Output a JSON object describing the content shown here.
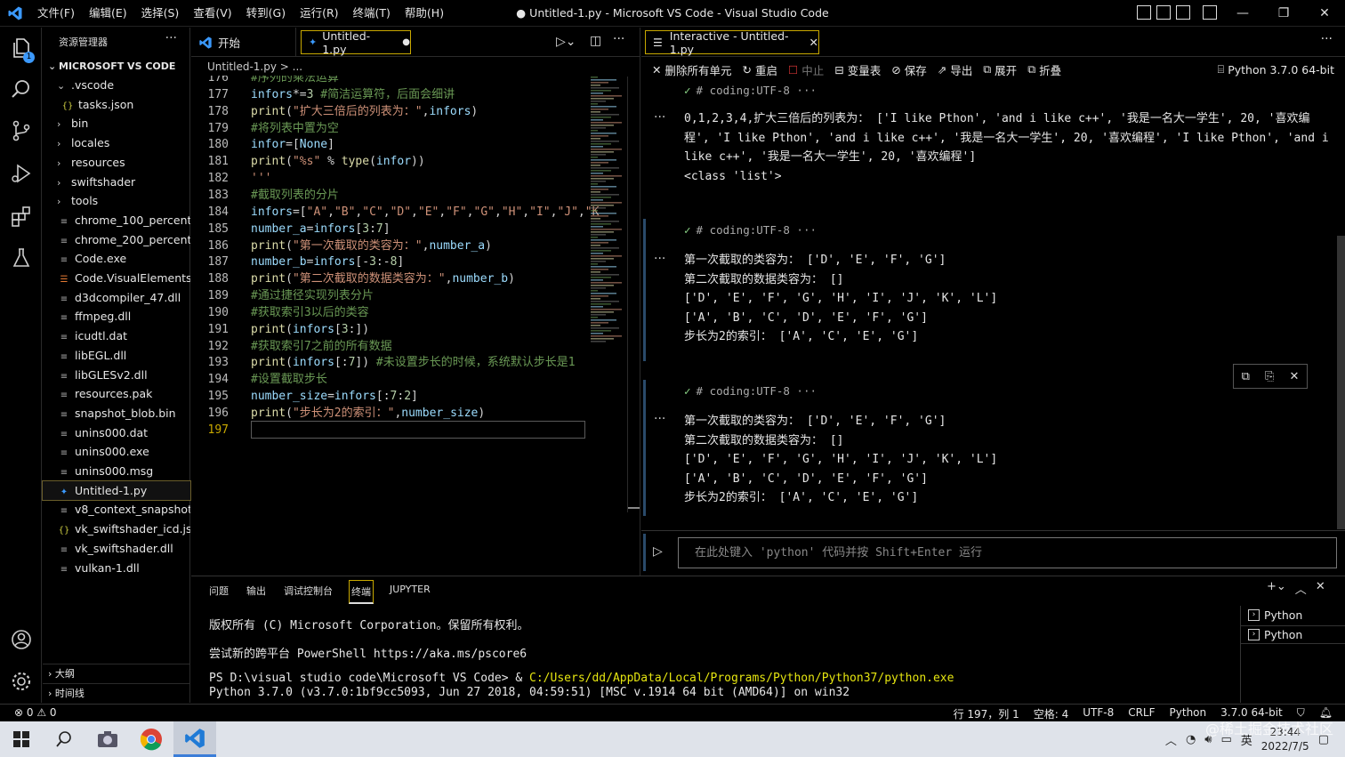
{
  "window": {
    "title": "● Untitled-1.py - Microsoft VS Code - Visual Studio Code",
    "menus": [
      "文件(F)",
      "编辑(E)",
      "选择(S)",
      "查看(V)",
      "转到(G)",
      "运行(R)",
      "终端(T)",
      "帮助(H)"
    ]
  },
  "activity": {
    "badge": "1"
  },
  "explorer": {
    "header": "资源管理器",
    "root": "MICROSOFT VS CODE",
    "items": [
      {
        "label": ".vscode",
        "kind": "folder-open",
        "indent": 1
      },
      {
        "label": "tasks.json",
        "kind": "json",
        "indent": 2
      },
      {
        "label": "bin",
        "kind": "folder",
        "indent": 1
      },
      {
        "label": "locales",
        "kind": "folder",
        "indent": 1
      },
      {
        "label": "resources",
        "kind": "folder",
        "indent": 1
      },
      {
        "label": "swiftshader",
        "kind": "folder",
        "indent": 1
      },
      {
        "label": "tools",
        "kind": "folder",
        "indent": 1
      },
      {
        "label": "chrome_100_percent....",
        "kind": "file",
        "indent": 1
      },
      {
        "label": "chrome_200_percent....",
        "kind": "file",
        "indent": 1
      },
      {
        "label": "Code.exe",
        "kind": "file",
        "indent": 1
      },
      {
        "label": "Code.VisualElements...",
        "kind": "rss",
        "indent": 1
      },
      {
        "label": "d3dcompiler_47.dll",
        "kind": "file",
        "indent": 1
      },
      {
        "label": "ffmpeg.dll",
        "kind": "file",
        "indent": 1
      },
      {
        "label": "icudtl.dat",
        "kind": "file",
        "indent": 1
      },
      {
        "label": "libEGL.dll",
        "kind": "file",
        "indent": 1
      },
      {
        "label": "libGLESv2.dll",
        "kind": "file",
        "indent": 1
      },
      {
        "label": "resources.pak",
        "kind": "file",
        "indent": 1
      },
      {
        "label": "snapshot_blob.bin",
        "kind": "file",
        "indent": 1
      },
      {
        "label": "unins000.dat",
        "kind": "file",
        "indent": 1
      },
      {
        "label": "unins000.exe",
        "kind": "file",
        "indent": 1
      },
      {
        "label": "unins000.msg",
        "kind": "file",
        "indent": 1
      },
      {
        "label": "Untitled-1.py",
        "kind": "python",
        "indent": 1,
        "selected": true
      },
      {
        "label": "v8_context_snapshot....",
        "kind": "file",
        "indent": 1
      },
      {
        "label": "vk_swiftshader_icd.json",
        "kind": "json",
        "indent": 1
      },
      {
        "label": "vk_swiftshader.dll",
        "kind": "file",
        "indent": 1
      },
      {
        "label": "vulkan-1.dll",
        "kind": "file",
        "indent": 1
      }
    ],
    "outline": "大纲",
    "timeline": "时间线"
  },
  "editor": {
    "tabs": [
      {
        "label": "开始",
        "icon": "vscode-icon"
      },
      {
        "label": "Untitled-1.py",
        "icon": "python-icon",
        "dirty": true
      }
    ],
    "breadcrumb": "Untitled-1.py > ...",
    "lines": [
      {
        "n": "176",
        "text": "#序列的乘法运算",
        "kind": "com"
      },
      {
        "n": "177",
        "text": "infors*=3 #简洁运算符，后面会细讲",
        "kind": "mix1"
      },
      {
        "n": "178",
        "text": "print(\"扩大三倍后的列表为：\",infors)",
        "kind": "mix2"
      },
      {
        "n": "179",
        "text": "#将列表中置为空",
        "kind": "com"
      },
      {
        "n": "180",
        "text": "infor=[None]",
        "kind": "var"
      },
      {
        "n": "181",
        "text": "print(\"%s\" % type(infor))",
        "kind": "mix2"
      },
      {
        "n": "182",
        "text": "'''",
        "kind": "str"
      },
      {
        "n": "183",
        "text": "#截取列表的分片",
        "kind": "com"
      },
      {
        "n": "184",
        "text": "infors=[\"A\",\"B\",\"C\",\"D\",\"E\",\"F\",\"G\",\"H\",\"I\",\"J\",\"K",
        "kind": "var"
      },
      {
        "n": "185",
        "text": "number_a=infors[3:7]",
        "kind": "var"
      },
      {
        "n": "186",
        "text": "print(\"第一次截取的类容为：\",number_a)",
        "kind": "mix2"
      },
      {
        "n": "187",
        "text": "number_b=infors[-3:-8]",
        "kind": "var"
      },
      {
        "n": "188",
        "text": "print(\"第二次截取的数据类容为：\",number_b)",
        "kind": "mix2"
      },
      {
        "n": "189",
        "text": "#通过捷径实现列表分片",
        "kind": "com"
      },
      {
        "n": "190",
        "text": "#获取索引3以后的类容",
        "kind": "com"
      },
      {
        "n": "191",
        "text": "print(infors[3:])",
        "kind": "mix2"
      },
      {
        "n": "192",
        "text": "#获取索引7之前的所有数据",
        "kind": "com"
      },
      {
        "n": "193",
        "text": "print(infors[:7]) #未设置步长的时候，系统默认步长是1",
        "kind": "mix2"
      },
      {
        "n": "194",
        "text": "#设置截取步长",
        "kind": "com"
      },
      {
        "n": "195",
        "text": "number_size=infors[:7:2]",
        "kind": "var"
      },
      {
        "n": "196",
        "text": "print(\"步长为2的索引：\",number_size)",
        "kind": "mix2"
      },
      {
        "n": "197",
        "text": "",
        "kind": "var"
      }
    ]
  },
  "interactive": {
    "tab": "Interactive - Untitled-1.py",
    "toolbar": {
      "clear": "删除所有单元",
      "restart": "重启",
      "interrupt": "中止",
      "variables": "变量表",
      "save": "保存",
      "export": "导出",
      "expand": "展开",
      "collapse": "折叠",
      "kernel": "Python 3.7.0 64-bit"
    },
    "cells": [
      {
        "header": "# coding:UTF-8 ···",
        "output": "0,1,2,3,4,扩大三倍后的列表为： ['I like Pthon', 'and i like c++', '我是一名大一学生', 20, '喜欢编程', 'I like Pthon', 'and i like c++', '我是一名大一学生', 20, '喜欢编程', 'I like Pthon', 'and i like c++', '我是一名大一学生', 20, '喜欢编程']\n<class 'list'>"
      },
      {
        "header": "# coding:UTF-8 ···",
        "output": "第一次截取的类容为： ['D', 'E', 'F', 'G']\n第二次截取的数据类容为： []\n['D', 'E', 'F', 'G', 'H', 'I', 'J', 'K', 'L']\n['A', 'B', 'C', 'D', 'E', 'F', 'G']\n步长为2的索引： ['A', 'C', 'E', 'G']"
      },
      {
        "header": "# coding:UTF-8 ···",
        "output": "第一次截取的类容为： ['D', 'E', 'F', 'G']\n第二次截取的数据类容为： []\n['D', 'E', 'F', 'G', 'H', 'I', 'J', 'K', 'L']\n['A', 'B', 'C', 'D', 'E', 'F', 'G']\n步长为2的索引： ['A', 'C', 'E', 'G']"
      }
    ],
    "input_placeholder": "在此处键入 'python' 代码并按 Shift+Enter 运行"
  },
  "panel": {
    "tabs": [
      "问题",
      "输出",
      "调试控制台",
      "终端",
      "JUPYTER"
    ],
    "active_tab": "终端",
    "terminal_lines": [
      "版权所有 (C) Microsoft Corporation。保留所有权利。",
      "尝试新的跨平台 PowerShell https://aka.ms/pscore6",
      "Python 3.7.0 (v3.7.0:1bf9cc5093, Jun 27 2018, 04:59:51) [MSC v.1914 64 bit (AMD64)] on win32"
    ],
    "prompt": "PS D:\\visual studio code\\Microsoft VS Code> & ",
    "prompt_path": "C:/Users/dd/AppData/Local/Programs/Python/Python37/python.exe",
    "terminals": [
      "Python",
      "Python"
    ]
  },
  "status": {
    "problems": "⊗ 0 ⚠ 0",
    "position": "行 197，列 1",
    "spaces": "空格: 4",
    "encoding": "UTF-8",
    "eol": "CRLF",
    "language": "Python",
    "interpreter": "3.7.0 64-bit"
  },
  "taskbar": {
    "ime": "英",
    "time": "23:44",
    "date": "2022/7/5"
  },
  "watermark": "@稀土掘金技术社区",
  "colors": {
    "accent_blue": "#3b99fc",
    "comment": "#6a9955",
    "variable": "#9cdcfe",
    "function": "#dcdcaa",
    "string": "#ce9178",
    "check": "#89d185"
  }
}
